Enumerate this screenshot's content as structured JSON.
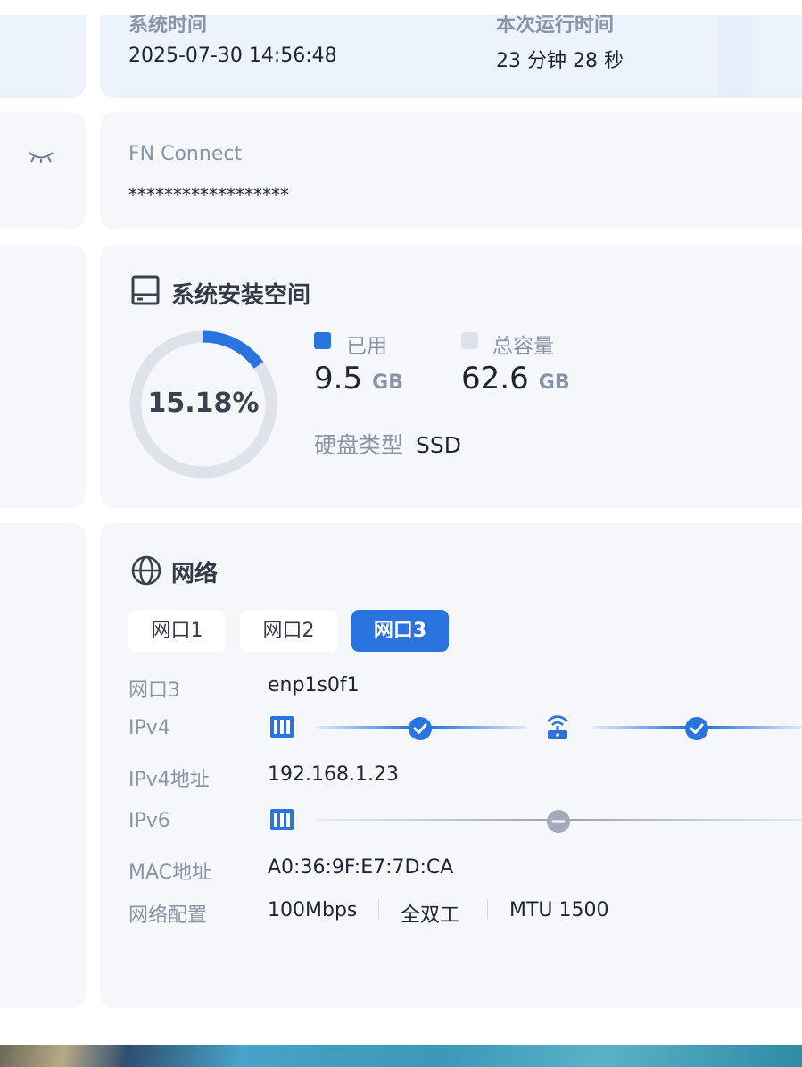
{
  "system_time": {
    "label": "系统时间",
    "value": "2025-07-30 14:56:48"
  },
  "uptime": {
    "label": "本次运行时间",
    "value": "23 分钟 28 秒"
  },
  "fn_connect": {
    "label": "FN Connect",
    "value": "******************"
  },
  "storage": {
    "title": "系统安装空间",
    "percent_label": "15.18%",
    "used_fraction": 0.1518,
    "used": {
      "label": "已用",
      "value": "9.5",
      "unit": "GB"
    },
    "total": {
      "label": "总容量",
      "value": "62.6",
      "unit": "GB"
    },
    "disk_type": {
      "label": "硬盘类型",
      "value": "SSD"
    },
    "colors": {
      "used": "#2a74e0",
      "free": "#dfe2e8"
    }
  },
  "network": {
    "title": "网络",
    "tabs": [
      {
        "label": "网口1",
        "active": false
      },
      {
        "label": "网口2",
        "active": false
      },
      {
        "label": "网口3",
        "active": true
      }
    ],
    "rows": {
      "iface": {
        "label": "网口3",
        "value": "enp1s0f1"
      },
      "ipv4": {
        "label": "IPv4"
      },
      "ipv4_addr": {
        "label": "IPv4地址",
        "value": "192.168.1.23"
      },
      "ipv6": {
        "label": "IPv6"
      },
      "mac": {
        "label": "MAC地址",
        "value": "A0:36:9F:E7:7D:CA"
      },
      "config": {
        "label": "网络配置",
        "speed": "100Mbps",
        "duplex": "全双工",
        "mtu": "MTU 1500"
      }
    },
    "ipv4_status": [
      "connected",
      "connected"
    ],
    "ipv6_status": [
      "disconnected"
    ],
    "accent": "#2a74e0"
  }
}
